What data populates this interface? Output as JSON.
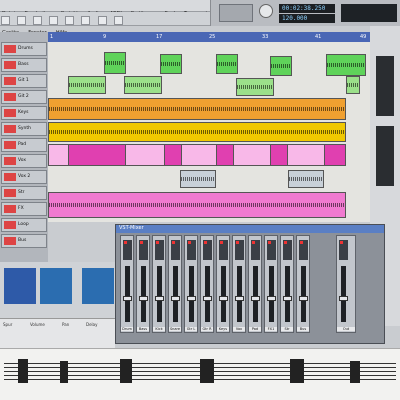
{
  "menu": {
    "items": [
      "Datei",
      "Bearbeiten",
      "Projekt",
      "Audio",
      "MIDI",
      "Partituren",
      "Pool",
      "Transport",
      "Geräte",
      "Fenster",
      "Hilfe"
    ]
  },
  "transport": {
    "position": "00:02:38.250",
    "tempo": "120.000"
  },
  "ruler": {
    "marks": [
      "1",
      "9",
      "17",
      "25",
      "33",
      "41",
      "49"
    ]
  },
  "tracks": {
    "names": [
      "Drums",
      "Bass",
      "Git 1",
      "Git 2",
      "Keys",
      "Synth",
      "Pad",
      "Vox",
      "Vox 2",
      "Str",
      "FX",
      "Loop",
      "Bus"
    ]
  },
  "mixer": {
    "title": "VST-Mixer",
    "channels": [
      "Drum",
      "Bass",
      "Kick",
      "Snare",
      "Gtr L",
      "Gtr R",
      "Keys",
      "Vox",
      "Pad",
      "FX1",
      "Str",
      "Bus",
      "Out"
    ]
  },
  "inspector": {
    "fields": [
      "Spur",
      "Volume",
      "Pan",
      "Delay"
    ]
  },
  "colors": {
    "green": "#5fd35a",
    "orange": "#f0a030",
    "yellow": "#f0c800",
    "magenta": "#e040b0",
    "pink": "#f07ad0",
    "gray_blue": "#c8d0d8"
  }
}
